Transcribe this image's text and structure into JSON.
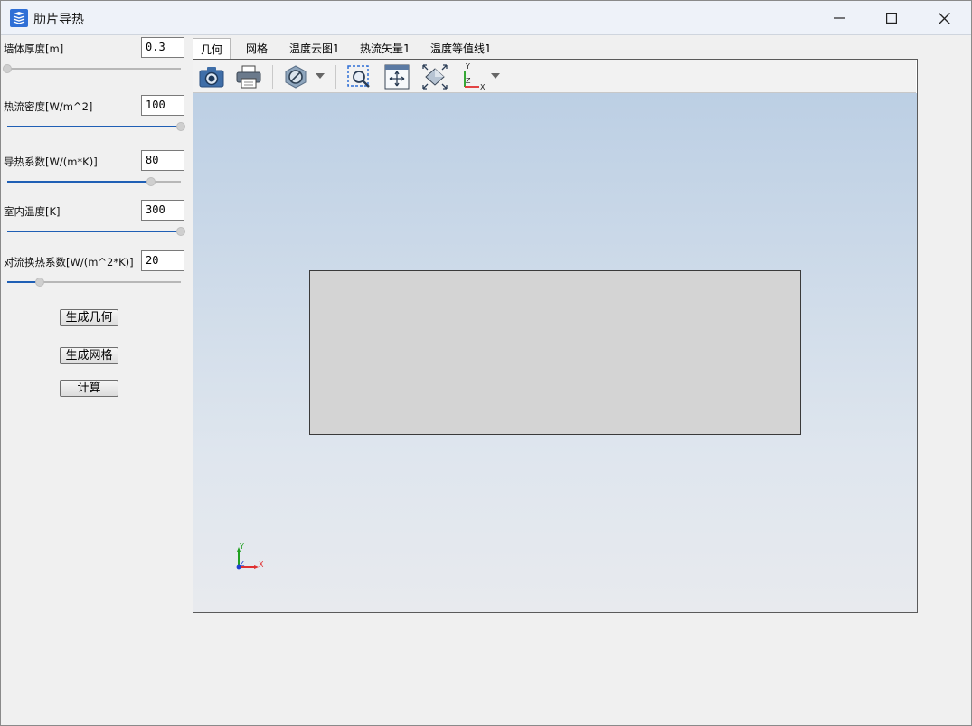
{
  "window": {
    "title": "肋片导热"
  },
  "params": [
    {
      "label": "墙体厚度[m]",
      "value": "0.3",
      "slider_fraction": 0.0
    },
    {
      "label": "热流密度[W/m^2]",
      "value": "100",
      "slider_fraction": 1.0
    },
    {
      "label": "导热系数[W/(m*K)]",
      "value": "80",
      "slider_fraction": 0.83
    },
    {
      "label": "室内温度[K]",
      "value": "300",
      "slider_fraction": 1.0
    },
    {
      "label": "对流换热系数[W/(m^2*K)]",
      "value": "20",
      "slider_fraction": 0.19
    }
  ],
  "buttons": {
    "generate_geometry": "生成几何",
    "generate_mesh": "生成网格",
    "compute": "计算"
  },
  "tabs": [
    {
      "label": "几何",
      "active": true
    },
    {
      "label": "网格",
      "active": false
    },
    {
      "label": "温度云图1",
      "active": false
    },
    {
      "label": "热流矢量1",
      "active": false
    },
    {
      "label": "温度等值线1",
      "active": false
    }
  ],
  "toolbar_icons": [
    "camera-icon",
    "print-icon",
    "no-entry-icon",
    "zoom-box-icon",
    "pan-icon",
    "fit-view-icon",
    "axis-view-icon"
  ],
  "triad": {
    "x": "X",
    "y": "Y",
    "z": "Z"
  },
  "colors": {
    "accent": "#1f5fb5",
    "axis_x": "#e03030",
    "axis_y": "#20a020",
    "axis_z": "#2040d0",
    "geometry_fill": "#d4d4d4"
  }
}
